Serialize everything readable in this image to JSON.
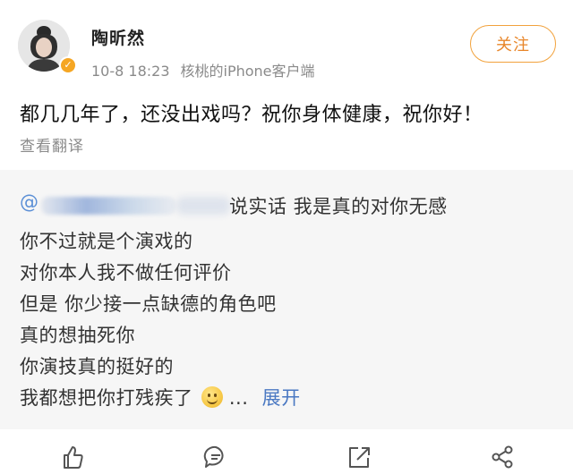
{
  "post": {
    "username": "陶昕然",
    "date": "10-8 18:23",
    "source": "核桃的iPhone客户端",
    "follow_label": "关注",
    "text": "都几几年了，还没出戏吗？祝你身体健康，祝你好！",
    "translate_label": "查看翻译"
  },
  "repost": {
    "at": "@",
    "lines": [
      "说实话 我是真的对你无感",
      "你不过就是个演戏的",
      "对你本人我不做任何评价",
      "但是 你少接一点缺德的角色吧",
      "真的想抽死你",
      "你演技真的挺好的",
      "我都想把你打残疾了"
    ],
    "ellipsis": "...",
    "expand_label": "展开"
  },
  "icons": {
    "verify": "verified-badge-icon",
    "like": "thumbs-up-icon",
    "comment": "comment-icon",
    "repost": "repost-icon",
    "share": "share-icon"
  },
  "colors": {
    "accent": "#f2a23c",
    "link": "#4a78c2",
    "muted": "#8a8a8a"
  }
}
